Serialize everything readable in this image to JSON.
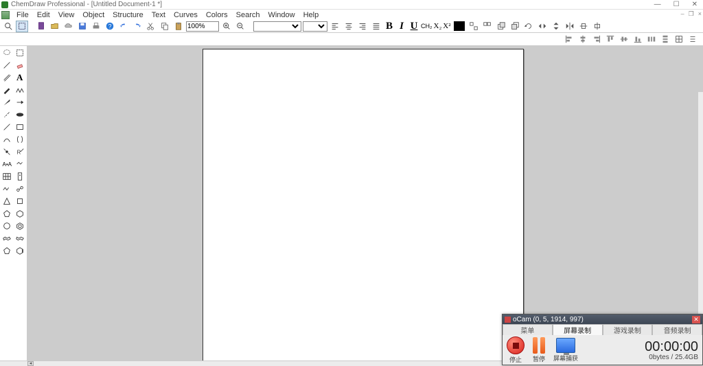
{
  "app": {
    "title": "ChemDraw Professional - [Untitled Document-1 *]"
  },
  "menu": [
    "File",
    "Edit",
    "View",
    "Object",
    "Structure",
    "Text",
    "Curves",
    "Colors",
    "Search",
    "Window",
    "Help"
  ],
  "toolbar": {
    "zoom": "100%",
    "font": "",
    "size": "",
    "bold": "B",
    "italic": "I",
    "underline": "U",
    "ch2": "CH₂",
    "sub": "X₂",
    "sup": "X²"
  },
  "ocam": {
    "title": "oCam (0, 5, 1914, 997)",
    "tabs": [
      "菜单",
      "屏幕录制",
      "游戏录制",
      "音频录制"
    ],
    "active_tab": 1,
    "stop": "停止",
    "pause": "暂停",
    "capture": "屏幕捕获",
    "time": "00:00:00",
    "bytes": "0bytes / 25.4GB"
  }
}
